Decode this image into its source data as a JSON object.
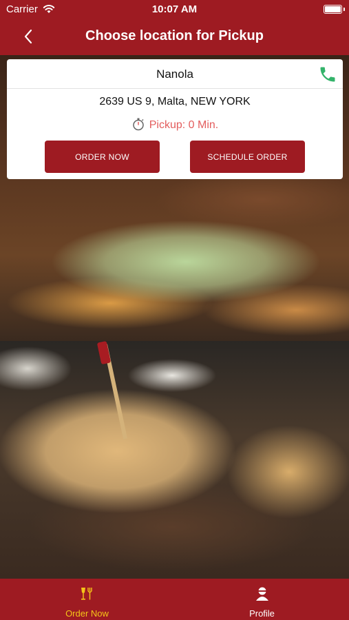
{
  "status_bar": {
    "carrier": "Carrier",
    "time": "10:07 AM"
  },
  "header": {
    "title": "Choose location for Pickup",
    "back_icon": "chevron-left-icon"
  },
  "location": {
    "name": "Nanola",
    "address": "2639 US 9, Malta, NEW YORK",
    "pickup_text": "Pickup: 0 Min.",
    "order_now_label": "ORDER NOW",
    "schedule_label": "SCHEDULE ORDER",
    "phone_icon": "phone-icon",
    "timer_icon": "stopwatch-icon"
  },
  "tabbar": {
    "tabs": [
      {
        "label": "Order Now",
        "icon": "dining-icon",
        "active": true
      },
      {
        "label": "Profile",
        "icon": "person-icon",
        "active": false
      }
    ]
  },
  "colors": {
    "brand": "#9e1b22",
    "accent_active_tab": "#f5c518",
    "pickup_text": "#e35d5d",
    "phone_icon": "#33b36a"
  }
}
